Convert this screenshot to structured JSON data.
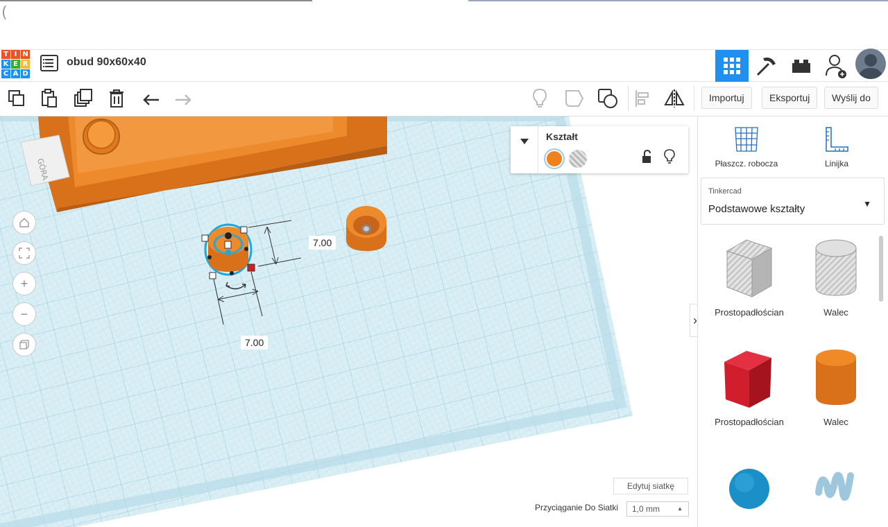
{
  "document": {
    "title": "obud 90x60x40"
  },
  "toolbar": {
    "import_label": "Importuj",
    "export_label": "Eksportuj",
    "send_label": "Wyślij do"
  },
  "view_cube": {
    "label": "GÓRA"
  },
  "inspector": {
    "title": "Kształt",
    "solid_color": "#f0821e",
    "hole_pattern": "striped-gray"
  },
  "workplane": {
    "dim_width": "7.00",
    "dim_depth": "7.00",
    "edit_grid_label": "Edytuj siatkę",
    "snap_label": "Przyciąganie Do Siatki",
    "snap_value": "1,0 mm"
  },
  "sidebar": {
    "workplane_label": "Płaszcz. robocza",
    "ruler_label": "Linijka",
    "library_brand": "Tinkercad",
    "library_name": "Podstawowe kształty",
    "shapes": [
      {
        "label": "Prostopadłościan",
        "icon": "box-hole-icon"
      },
      {
        "label": "Walec",
        "icon": "cylinder-hole-icon"
      },
      {
        "label": "Prostopadłościan",
        "icon": "box-red-icon"
      },
      {
        "label": "Walec",
        "icon": "cylinder-orange-icon"
      },
      {
        "label": "",
        "icon": "sphere-blue-icon"
      },
      {
        "label": "",
        "icon": "scribble-icon"
      }
    ]
  },
  "colors": {
    "accent": "#1f8ff0",
    "orange": "#e67e22",
    "grid": "#d9f0f6"
  }
}
